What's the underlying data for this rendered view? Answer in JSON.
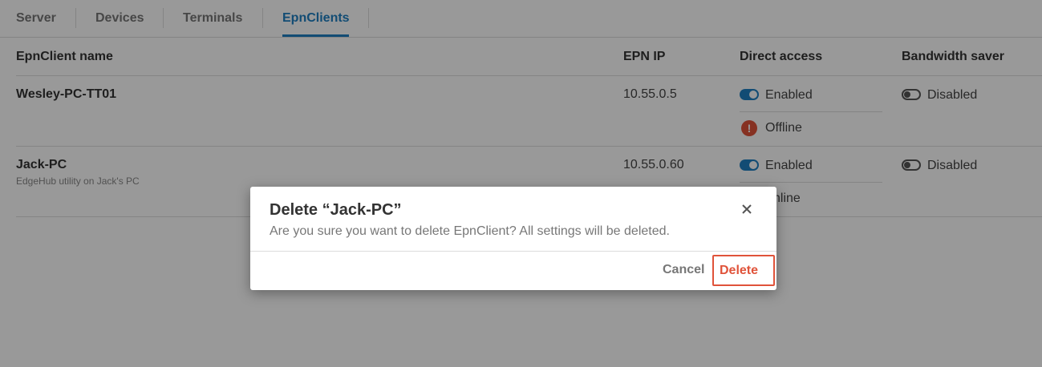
{
  "tabs": [
    {
      "label": "Server",
      "active": false
    },
    {
      "label": "Devices",
      "active": false
    },
    {
      "label": "Terminals",
      "active": false
    },
    {
      "label": "EpnClients",
      "active": true
    }
  ],
  "table": {
    "columns": [
      "EpnClient name",
      "EPN IP",
      "Direct access",
      "Bandwidth saver"
    ],
    "rows": [
      {
        "name": "Wesley-PC-TT01",
        "description": "",
        "ip": "10.55.0.5",
        "direct_access": "Enabled",
        "direct_access_on": true,
        "status": "Offline",
        "bandwidth_saver": "Disabled",
        "bandwidth_saver_on": false
      },
      {
        "name": "Jack-PC",
        "description": "EdgeHub utility on Jack's PC",
        "ip": "10.55.0.60",
        "direct_access": "Enabled",
        "direct_access_on": true,
        "status": "nline",
        "bandwidth_saver": "Disabled",
        "bandwidth_saver_on": false
      }
    ]
  },
  "dialog": {
    "title": "Delete “Jack-PC”",
    "message": "Are you sure you want to delete EpnClient? All settings will be deleted.",
    "cancel_label": "Cancel",
    "delete_label": "Delete",
    "close_icon": "close-icon"
  },
  "colors": {
    "accent": "#1f7fc2",
    "danger": "#e0533a",
    "overlay": "rgba(0,0,0,0.4)"
  },
  "icons": {
    "status_offline": "exclamation-circle-icon",
    "toggle_on": "toggle-on-icon",
    "toggle_off": "toggle-off-icon"
  }
}
